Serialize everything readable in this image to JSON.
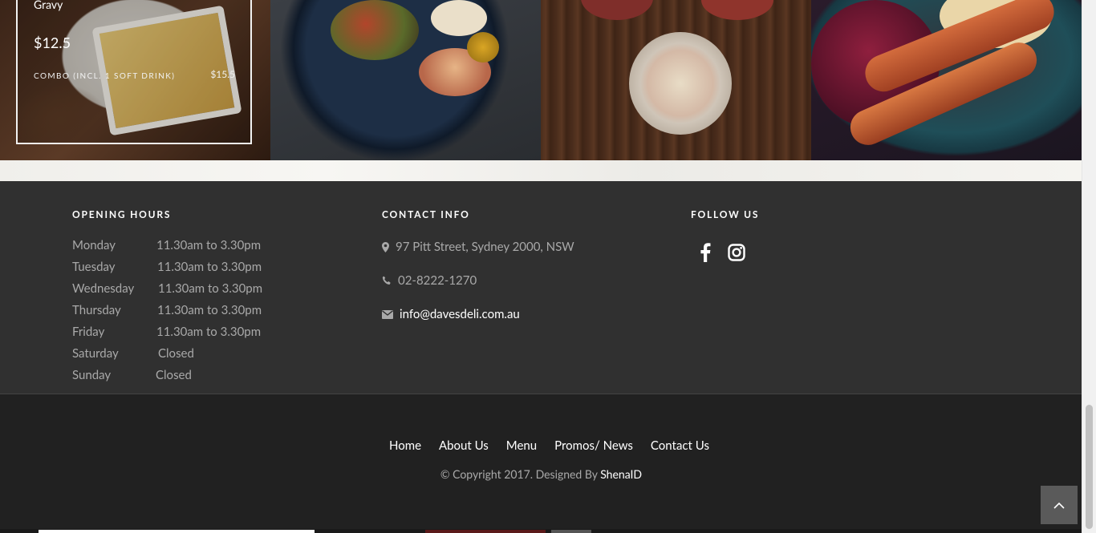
{
  "menu_card": {
    "title": "Gravy",
    "price": "$12.5",
    "combo_label": "COMBO (INCL. 1 SOFT DRINK)",
    "combo_price": "$15.5"
  },
  "opening_hours": {
    "heading": "OPENING HOURS",
    "rows": [
      {
        "day": "Monday",
        "time": "11.30am to 3.30pm"
      },
      {
        "day": "Tuesday",
        "time": "11.30am to 3.30pm"
      },
      {
        "day": "Wednesday",
        "time": "11.30am to 3.30pm"
      },
      {
        "day": "Thursday",
        "time": "11.30am to 3.30pm"
      },
      {
        "day": "Friday",
        "time": "11.30am to 3.30pm"
      },
      {
        "day": "Saturday",
        "time": "Closed"
      },
      {
        "day": "Sunday",
        "time": "Closed"
      }
    ]
  },
  "contact": {
    "heading": "CONTACT INFO",
    "address": "97 Pitt Street, Sydney 2000, NSW",
    "phone": "02-8222-1270",
    "email": "info@davesdeli.com.au"
  },
  "follow": {
    "heading": "FOLLOW US",
    "icons": [
      "facebook-icon",
      "instagram-icon"
    ]
  },
  "nav": {
    "home": "Home",
    "about": "About Us",
    "menu": "Menu",
    "promos": "Promos/ News",
    "contact": "Contact Us"
  },
  "copyright": {
    "text": "© Copyright 2017. Designed By ",
    "brand": "ShenaID"
  },
  "colors": {
    "footer_top_bg": "#303030",
    "footer_bottom_bg": "#212121",
    "text_muted": "#a9a9a9"
  }
}
